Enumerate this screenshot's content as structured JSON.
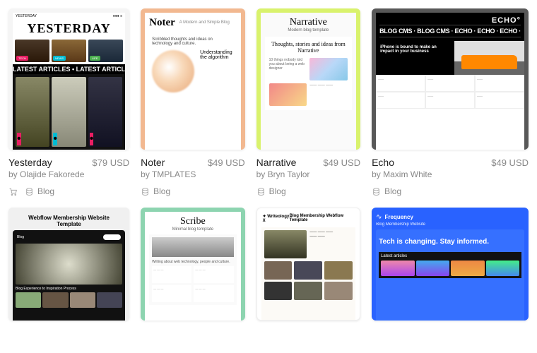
{
  "templates": [
    {
      "name": "Yesterday",
      "price": "$79 USD",
      "author": "by Olajide Fakorede",
      "tags": [
        "Blog"
      ],
      "hasCart": true,
      "thumb": {
        "heading": "YESTERDAY",
        "band": "LATEST ARTICLES • LATEST ARTICL"
      }
    },
    {
      "name": "Noter",
      "price": "$49 USD",
      "author": "by TMPLATES",
      "tags": [
        "Blog"
      ],
      "hasCart": false,
      "thumb": {
        "logo": "Noter",
        "sub": "A Modern and Simple Blog",
        "tagline": "Scribbled thoughts and ideas on technology and culture.",
        "article": "Understanding the algorithm"
      }
    },
    {
      "name": "Narrative",
      "price": "$49 USD",
      "author": "by Bryn Taylor",
      "tags": [
        "Blog"
      ],
      "hasCart": false,
      "thumb": {
        "logo": "Narrative",
        "sub": "Modern blog template",
        "hero": "Thoughts, stories and ideas from Narrative",
        "article": "10 things nobody told you about being a web designer"
      }
    },
    {
      "name": "Echo",
      "price": "$49 USD",
      "author": "by Maxim White",
      "tags": [
        "Blog"
      ],
      "hasCart": false,
      "thumb": {
        "logo": "ECHO°",
        "marquee": "BLOG CMS · BLOG CMS · ECHO · ECHO · ECHO ·",
        "hero": "iPhone is bound to make an impact in your business"
      }
    }
  ],
  "row2": [
    {
      "thumb": {
        "heading": "Webflow Membership Website Template",
        "nav": "Blog",
        "cap": "Blog Experience to Inspiration Process"
      }
    },
    {
      "thumb": {
        "logo": "Scribe",
        "sub": "Minimal blog template"
      }
    },
    {
      "thumb": {
        "logo": "✦ Writeology X",
        "heading": "Blog Membership Webflow Template"
      }
    },
    {
      "thumb": {
        "logo": "Frequency",
        "sub": "Blog Membership Website",
        "hero": "Tech is changing. Stay informed.",
        "band": "Latest articles"
      }
    }
  ]
}
